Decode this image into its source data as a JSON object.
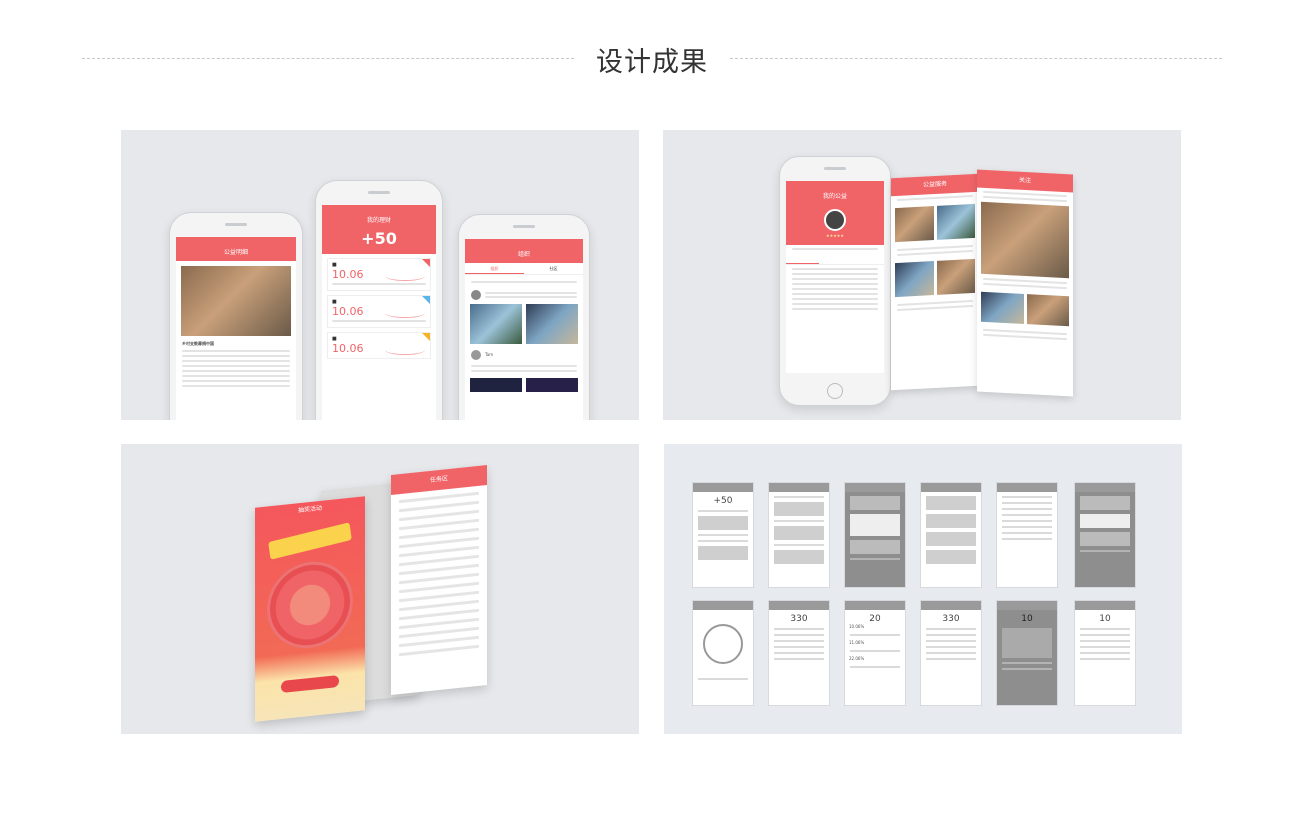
{
  "header": {
    "title": "设计成果"
  },
  "panel1": {
    "phone_left": {
      "title": "公益明细",
      "project": "乡村支教募捐中国"
    },
    "phone_center": {
      "title": "我的理财",
      "total": "+50",
      "rates": [
        "10.06",
        "10.06",
        "10.06"
      ]
    },
    "phone_right": {
      "title": "组织",
      "tabs": [
        "组织",
        "社区"
      ],
      "user": "Tam"
    }
  },
  "panel2": {
    "phone_title": "我的公益",
    "board1_title": "公益服务",
    "board2_title": "关注"
  },
  "panel3": {
    "poster_title": "抽奖活动",
    "sheet_title": "任务区"
  },
  "panel4": {
    "numbers": [
      "+50",
      "330",
      "20",
      "330",
      "10",
      "10"
    ],
    "percents": [
      "10.06%",
      "11.06%",
      "22.06%"
    ]
  }
}
